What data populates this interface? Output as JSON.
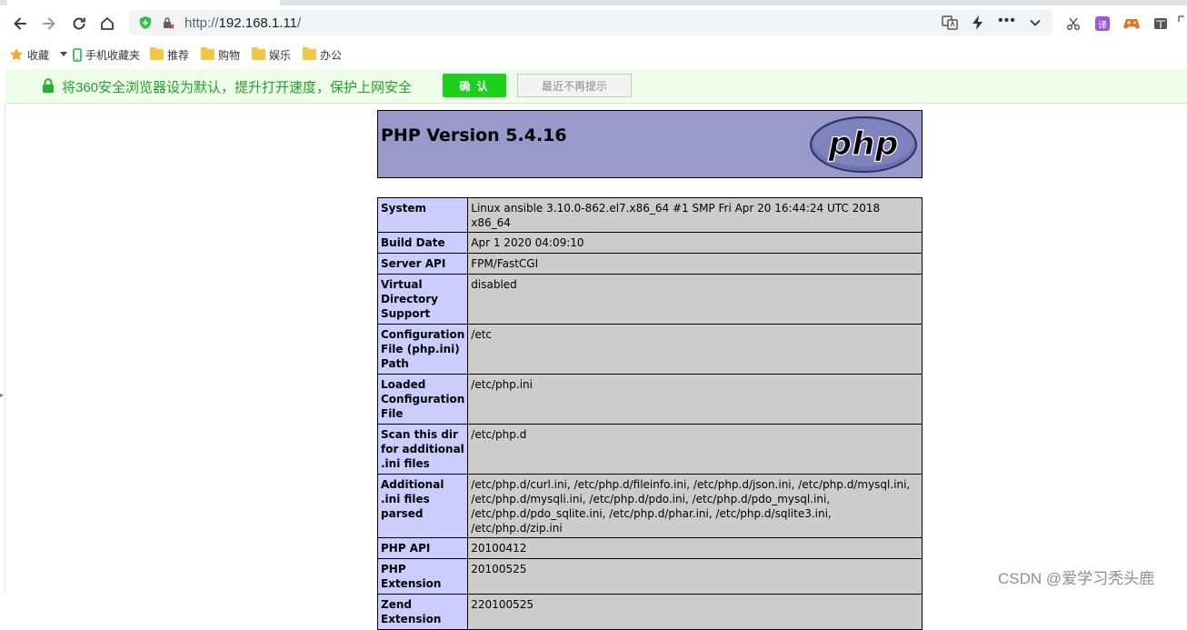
{
  "browser": {
    "url_prefix": "http://",
    "url_host": "192.168.1.11",
    "url_suffix": "/"
  },
  "bookmarks": [
    {
      "label": "收藏",
      "icon": "star-icon"
    },
    {
      "label": "手机收藏夹",
      "icon": "phone-icon"
    },
    {
      "label": "推荐",
      "icon": "folder-icon"
    },
    {
      "label": "购物",
      "icon": "folder-icon"
    },
    {
      "label": "娱乐",
      "icon": "folder-icon"
    },
    {
      "label": "办公",
      "icon": "folder-icon"
    }
  ],
  "notification": {
    "text": "将360安全浏览器设为默认，提升打开速度，保护上网安全",
    "confirm_label": "确 认",
    "dismiss_label": "最近不再提示"
  },
  "phpinfo": {
    "title": "PHP Version 5.4.16",
    "rows": [
      {
        "key": "System",
        "value": "Linux ansible 3.10.0-862.el7.x86_64 #1 SMP Fri Apr 20 16:44:24 UTC 2018 x86_64"
      },
      {
        "key": "Build Date",
        "value": "Apr 1 2020 04:09:10"
      },
      {
        "key": "Server API",
        "value": "FPM/FastCGI"
      },
      {
        "key": "Virtual Directory Support",
        "value": "disabled"
      },
      {
        "key": "Configuration File (php.ini) Path",
        "value": "/etc"
      },
      {
        "key": "Loaded Configuration File",
        "value": "/etc/php.ini"
      },
      {
        "key": "Scan this dir for additional .ini files",
        "value": "/etc/php.d"
      },
      {
        "key": "Additional .ini files parsed",
        "value": "/etc/php.d/curl.ini, /etc/php.d/fileinfo.ini, /etc/php.d/json.ini, /etc/php.d/mysql.ini, /etc/php.d/mysqli.ini, /etc/php.d/pdo.ini, /etc/php.d/pdo_mysql.ini, /etc/php.d/pdo_sqlite.ini, /etc/php.d/phar.ini, /etc/php.d/sqlite3.ini, /etc/php.d/zip.ini"
      },
      {
        "key": "PHP API",
        "value": "20100412"
      },
      {
        "key": "PHP Extension",
        "value": "20100525"
      },
      {
        "key": "Zend Extension",
        "value": "220100525"
      }
    ]
  },
  "watermark": "CSDN @爱学习秃头鹿",
  "colors": {
    "php_header": "#9999cc",
    "key_cell": "#ccccff",
    "value_cell": "#cccccc",
    "notify_green": "#23a22b",
    "confirm_button": "#1bd11b"
  }
}
